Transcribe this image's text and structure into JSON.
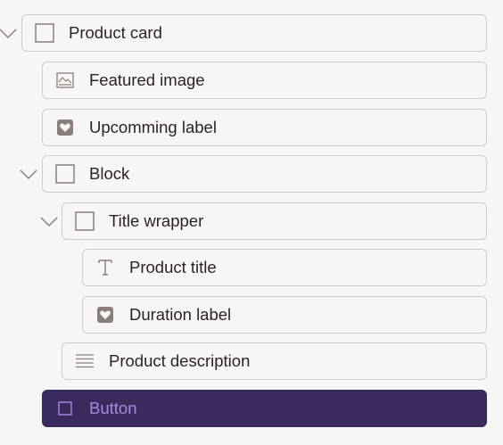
{
  "tree": {
    "items": [
      {
        "label": "Product card",
        "icon": "square-icon",
        "expanded": true
      },
      {
        "label": "Featured image",
        "icon": "image-icon"
      },
      {
        "label": "Upcomming label",
        "icon": "heart-badge-icon"
      },
      {
        "label": "Block",
        "icon": "square-icon",
        "expanded": true
      },
      {
        "label": "Title wrapper",
        "icon": "square-icon",
        "expanded": true
      },
      {
        "label": "Product title",
        "icon": "text-icon"
      },
      {
        "label": "Duration label",
        "icon": "heart-badge-icon"
      },
      {
        "label": "Product description",
        "icon": "paragraph-icon"
      },
      {
        "label": "Button",
        "icon": "square-icon",
        "selected": true
      }
    ]
  },
  "colors": {
    "background": "#f8f6f4",
    "border": "#cfcbc8",
    "text": "#2b2424",
    "icon": "#8a7f7d",
    "selected_bg": "#3b2b5d",
    "selected_text": "#a58ae0"
  }
}
